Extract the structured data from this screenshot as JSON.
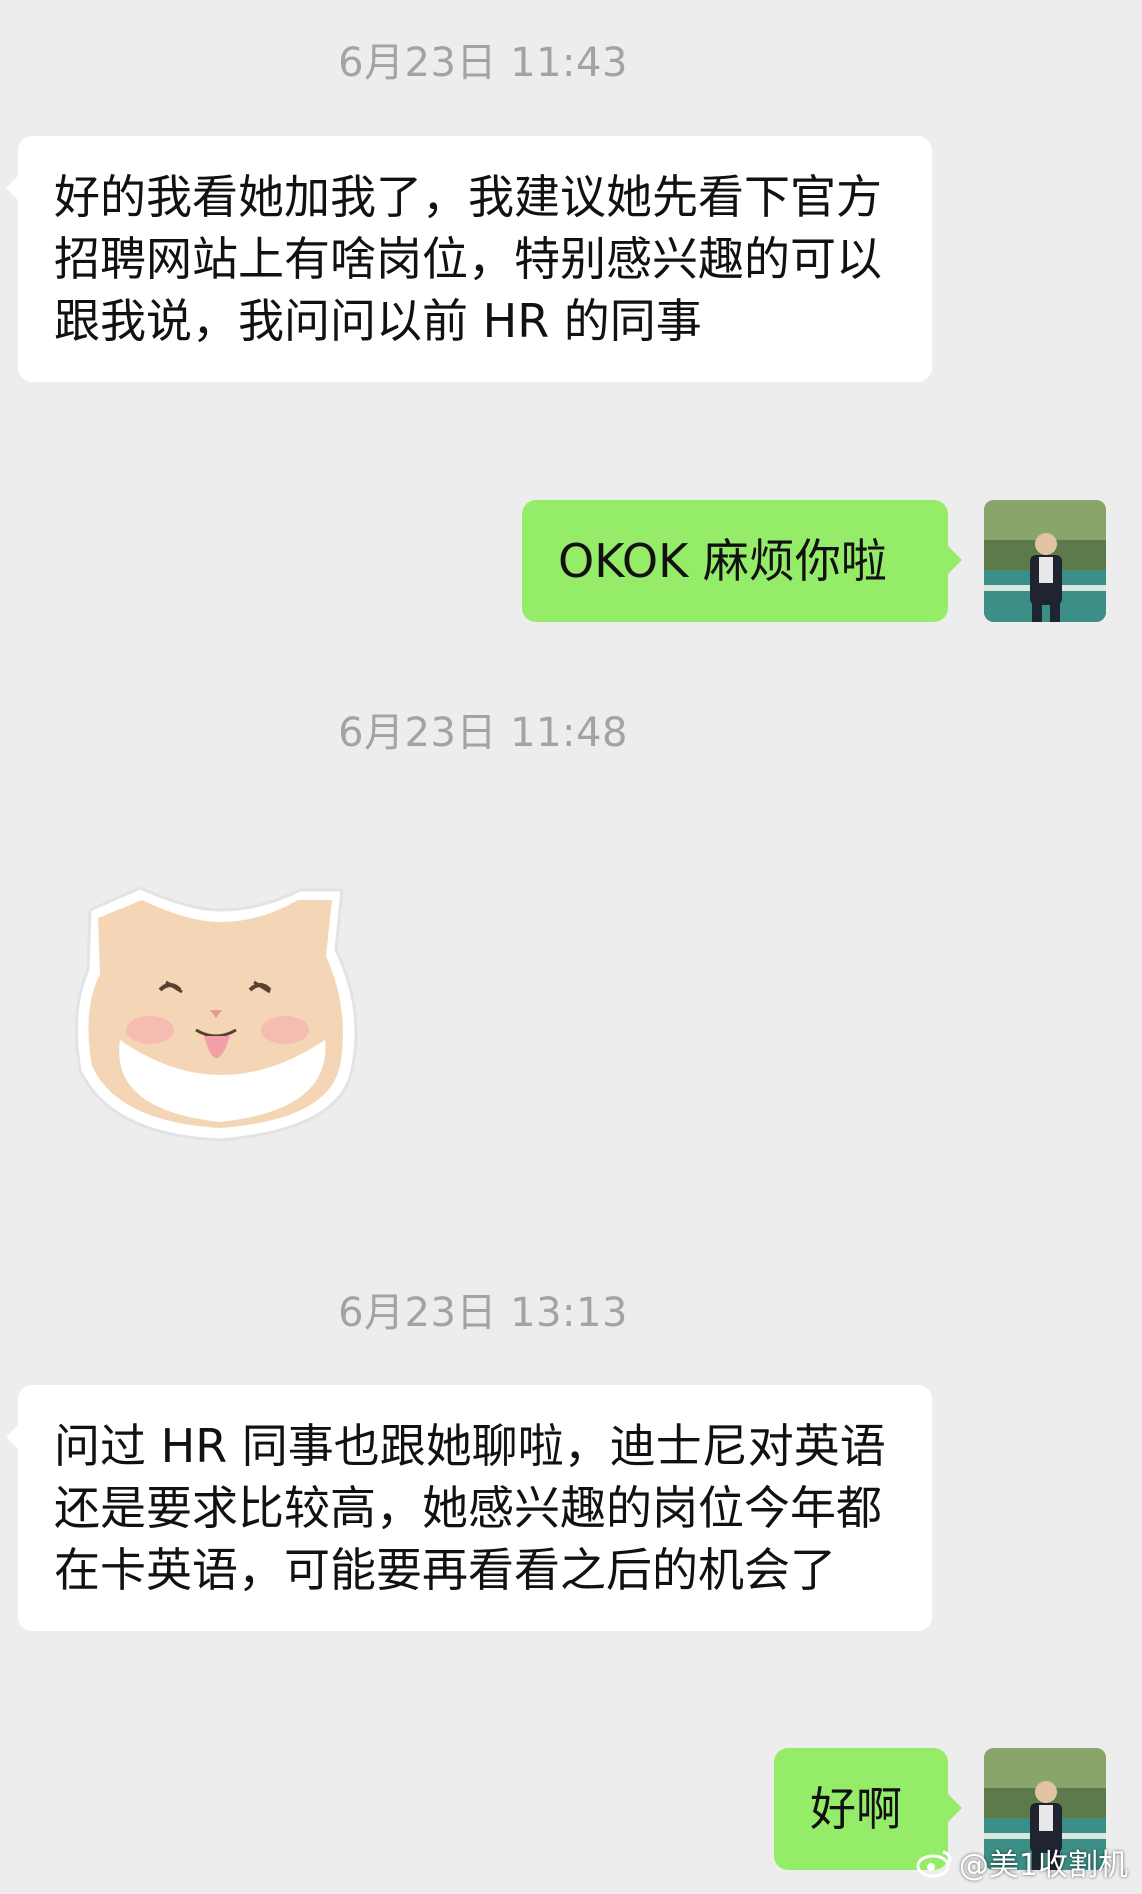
{
  "timestamps": [
    "6月23日 11:43",
    "6月23日 11:48",
    "6月23日 13:13"
  ],
  "messages": {
    "m1": "好的我看她加我了，我建议她先看下官方招聘网站上有啥岗位，特别感兴趣的可以跟我说，我问问以前 HR 的同事",
    "m2": "OKOK 麻烦你啦",
    "m4": "问过 HR 同事也跟她聊啦，迪士尼对英语还是要求比较高，她感兴趣的岗位今年都在卡英语，可能要再看看之后的机会了",
    "m5": "好啊"
  },
  "watermark": "@美1收割机",
  "icons": {
    "sticker": "smiling-cat-sticker",
    "weibo": "weibo-logo-icon"
  },
  "colors": {
    "background": "#ededed",
    "incoming_bubble": "#ffffff",
    "outgoing_bubble": "#95ec69",
    "timestamp": "#a3a3a3"
  }
}
